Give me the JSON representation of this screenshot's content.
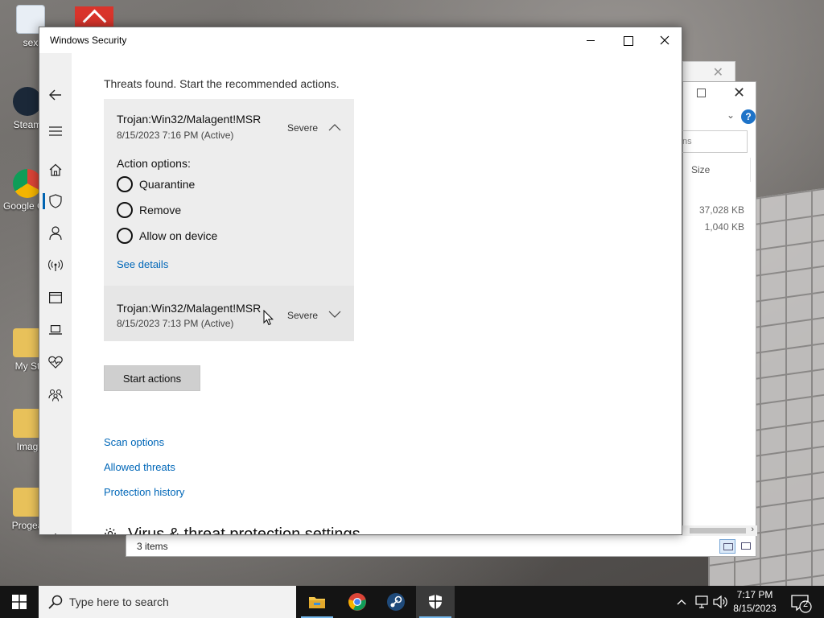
{
  "desktop": {
    "icons": [
      {
        "label": "sex",
        "color": "#e8eef5"
      },
      {
        "label": "Steam",
        "color": "#1b2838"
      },
      {
        "label": "Google Chrome",
        "color": "#e8e8e8"
      },
      {
        "label": "My St",
        "color": "#e8c15a"
      },
      {
        "label": "Imag",
        "color": "#e8c15a"
      },
      {
        "label": "Progea",
        "color": "#e8c15a"
      }
    ]
  },
  "explorer": {
    "search_placeholder": "ns",
    "column_size": "Size",
    "rows": [
      {
        "size": "37,028 KB"
      },
      {
        "size": "1,040 KB"
      }
    ],
    "status_items": "3 items"
  },
  "window": {
    "title": "Windows Security"
  },
  "nav": {
    "items": [
      "back-icon",
      "menu-icon",
      "home-icon",
      "shield-icon",
      "account-icon",
      "network-icon",
      "app-browser-icon",
      "device-security-icon",
      "health-icon",
      "family-icon",
      "settings-icon"
    ],
    "active": "shield-icon"
  },
  "main": {
    "threats_text": "Threats found. Start the recommended actions.",
    "threats": [
      {
        "name": "Trojan:Win32/Malagent!MSR",
        "date": "8/15/2023 7:16 PM (Active)",
        "severity": "Severe",
        "expanded": true
      },
      {
        "name": "Trojan:Win32/Malagent!MSR",
        "date": "8/15/2023 7:13 PM (Active)",
        "severity": "Severe",
        "expanded": false
      }
    ],
    "action_options_title": "Action options:",
    "action_options": [
      "Quarantine",
      "Remove",
      "Allow on device"
    ],
    "see_details": "See details",
    "start_actions": "Start actions",
    "links": [
      "Scan options",
      "Allowed threats",
      "Protection history"
    ],
    "settings_heading": "Virus & threat protection settings"
  },
  "taskbar": {
    "search_placeholder": "Type here to search",
    "apps": [
      "file-explorer-icon",
      "chrome-icon",
      "steam-icon",
      "windows-security-icon"
    ],
    "time": "7:17 PM",
    "date": "8/15/2023",
    "notification_count": "2",
    "accent": "#76b9ed"
  }
}
